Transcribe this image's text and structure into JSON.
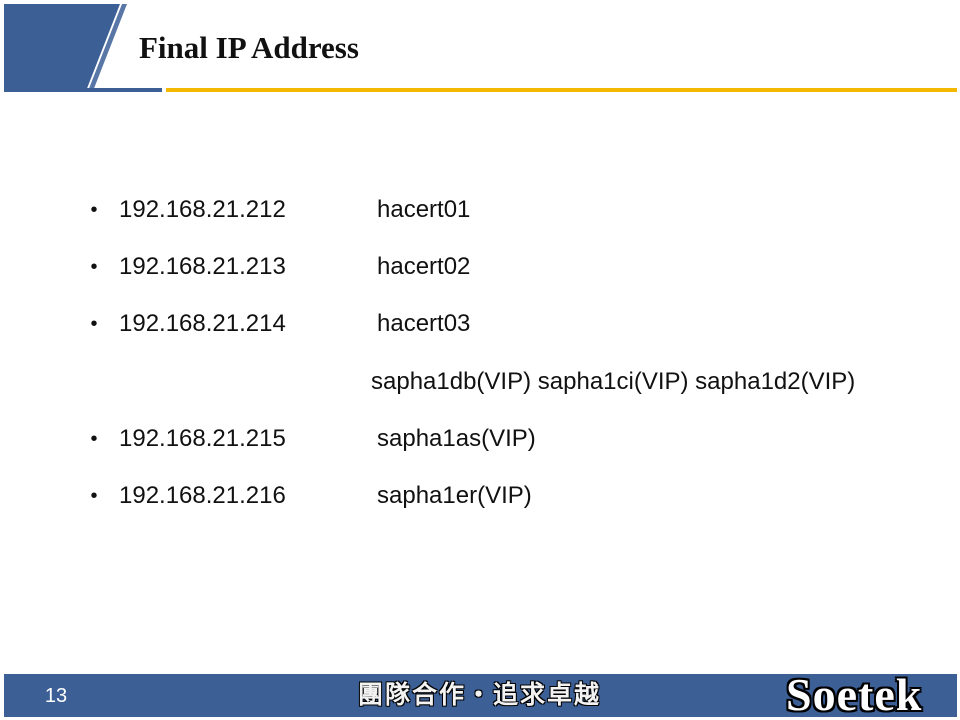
{
  "slide": {
    "title": "Final IP Address",
    "colors": {
      "header_blue": "#3c5f96",
      "accent_gold": "#f5b800",
      "footer_blue": "#3c5f96",
      "text": "#111111"
    }
  },
  "content": {
    "bullet_glyph": "•",
    "items": [
      {
        "ip": "192.168.21.212",
        "host": "hacert01"
      },
      {
        "ip": "192.168.21.213",
        "host": "hacert02"
      },
      {
        "ip": "192.168.21.214",
        "host": "hacert03"
      },
      {
        "ip": "192.168.21.215",
        "host": "sapha1as(VIP)"
      },
      {
        "ip": "192.168.21.216",
        "host": "sapha1er(VIP)"
      }
    ],
    "vip_line": "sapha1db(VIP) sapha1ci(VIP) sapha1d2(VIP)"
  },
  "footer": {
    "page_number": "13",
    "slogan": "團隊合作・追求卓越",
    "logo_text": "Soetek"
  }
}
